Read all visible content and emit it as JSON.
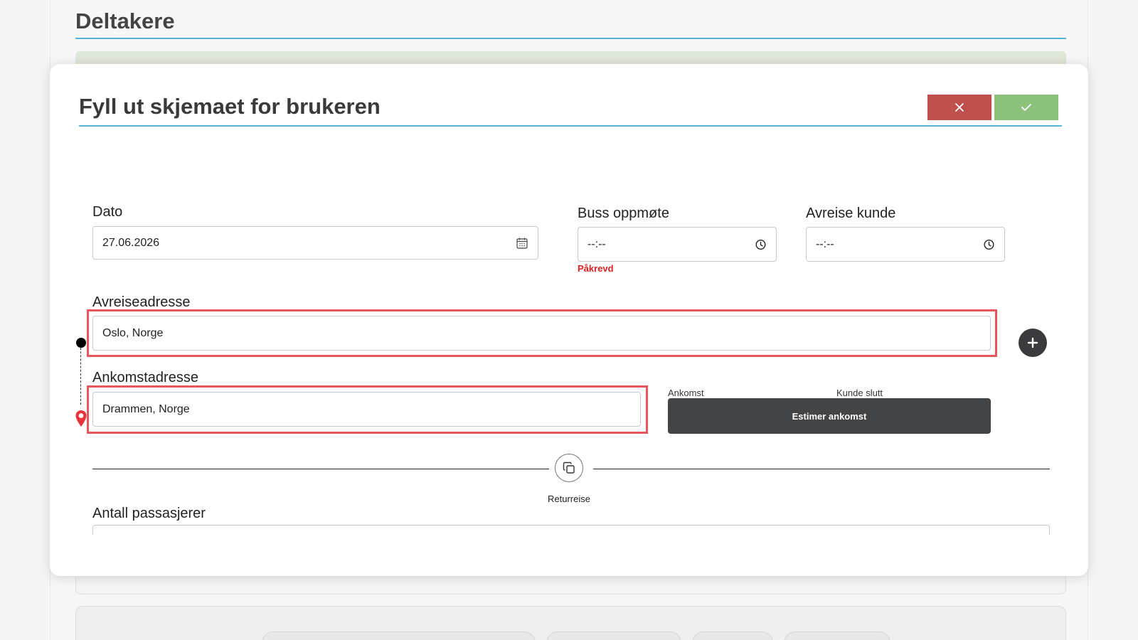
{
  "background": {
    "title": "Deltakere"
  },
  "modal": {
    "title": "Fyll ut skjemaet for brukeren",
    "close_icon": "close-icon",
    "confirm_icon": "check-icon"
  },
  "form": {
    "date": {
      "label": "Dato",
      "value": "27.06.2026",
      "icon": "calendar-icon"
    },
    "bus_meetup": {
      "label": "Buss oppmøte",
      "value": "--:--",
      "icon": "clock-icon",
      "error": "Påkrevd"
    },
    "customer_departure": {
      "label": "Avreise kunde",
      "value": "--:--",
      "icon": "clock-icon"
    },
    "departure_address": {
      "label": "Avreiseadresse",
      "value": "Oslo, Norge"
    },
    "arrival_address": {
      "label": "Ankomstadresse",
      "value": "Drammen, Norge"
    },
    "arrival_label": "Ankomst",
    "customer_end_label": "Kunde slutt",
    "estimate_button": "Estimer ankomst",
    "return_trip": "Returreise",
    "passengers": {
      "label": "Antall passasjerer",
      "value": ""
    }
  },
  "colors": {
    "accent_line": "#5ab4d6",
    "close_button": "#c0504d",
    "confirm_button": "#8cc27d",
    "highlight": "#e8555a",
    "error": "#e02020",
    "dark_button": "#434446"
  }
}
